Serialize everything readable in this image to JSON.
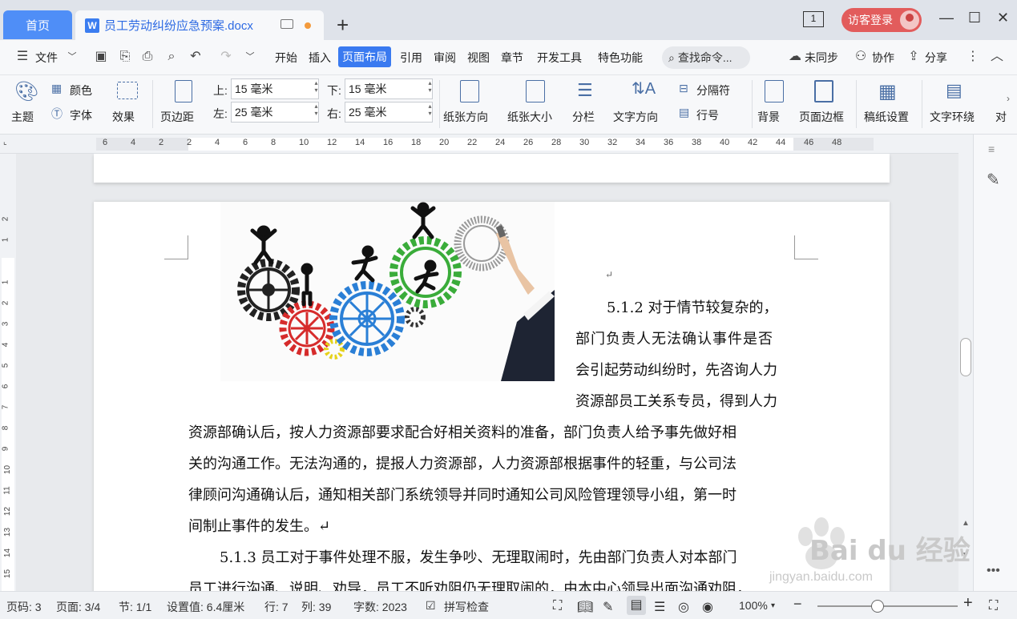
{
  "tabs": {
    "home_label": "首页",
    "doc_icon": "W",
    "doc_title": "员工劳动纠纷应急预案.docx"
  },
  "titlebar": {
    "window_count": "1",
    "login_label": "访客登录",
    "minimize": "—",
    "maximize": "☐",
    "close": "✕"
  },
  "menu": {
    "file_label": "文件",
    "items": [
      "开始",
      "插入",
      "页面布局",
      "引用",
      "审阅",
      "视图",
      "章节",
      "开发工具",
      "特色功能"
    ],
    "active": "页面布局",
    "search_label": "查找命令...",
    "sync_label": "未同步",
    "collab_label": "协作",
    "share_label": "分享"
  },
  "ribbon": {
    "theme_label": "主题",
    "color_label": "颜色",
    "font_label": "字体",
    "effect_label": "效果",
    "margin_label": "页边距",
    "top_label": "上:",
    "top_value": "15 毫米",
    "bottom_label": "下:",
    "bottom_value": "15 毫米",
    "left_label": "左:",
    "left_value": "25 毫米",
    "right_label": "右:",
    "right_value": "25 毫米",
    "orientation_label": "纸张方向",
    "size_label": "纸张大小",
    "columns_label": "分栏",
    "text_dir_label": "文字方向",
    "separator_label": "分隔符",
    "line_num_label": "行号",
    "background_label": "背景",
    "page_border_label": "页面边框",
    "grid_paper_label": "稿纸设置",
    "wrap_label": "文字环绕",
    "align_label": "对"
  },
  "ruler": {
    "ticks": [
      "6",
      "4",
      "2",
      "2",
      "4",
      "6",
      "8",
      "10",
      "12",
      "14",
      "16",
      "18",
      "20",
      "22",
      "24",
      "26",
      "28",
      "30",
      "32",
      "34",
      "36",
      "38",
      "40",
      "42",
      "44",
      "46",
      "48"
    ]
  },
  "vruler": {
    "ticks": [
      "2",
      "1",
      "1",
      "2",
      "3",
      "4",
      "5",
      "6",
      "7",
      "8",
      "9",
      "10",
      "11",
      "12",
      "13",
      "14",
      "15"
    ]
  },
  "document": {
    "mark_1": "↵",
    "para_1_lines": [
      "5.1.2 对于情节较复杂的，",
      "部门负责人无法确认事件是否",
      "会引起劳动纠纷时，先咨询人力",
      "资源部员工关系专员，得到人力",
      "资源部确认后，按人力资源部要求配合好相关资料的准备，部门负责人给予事先做好相",
      "关的沟通工作。无法沟通的，提报人力资源部，人力资源部根据事件的轻重，与公司法",
      "律顾问沟通确认后，通知相关部门系统领导并同时通知公司风险管理领导小组，第一时",
      "间制止事件的发生。↵"
    ],
    "para_2_lines": [
      "5.1.3 员工对于事件处理不服，发生争吵、无理取闹时，先由部门负责人对本部门",
      "员工进行沟通、说明、劝导，员工不听劝阻仍无理取闹的，由本中心领导出面沟通劝阻，"
    ]
  },
  "statusbar": {
    "page_code": "页码: 3",
    "page": "页面: 3/4",
    "section": "节: 1/1",
    "setting": "设置值: 6.4厘米",
    "row": "行: 7",
    "col": "列: 39",
    "word_count": "字数: 2023",
    "spell_check": "拼写检查",
    "zoom": "100%"
  },
  "zoom_level_percent": 100,
  "watermark": {
    "brand": "Bai du 经验",
    "url": "jingyan.baidu.com"
  }
}
